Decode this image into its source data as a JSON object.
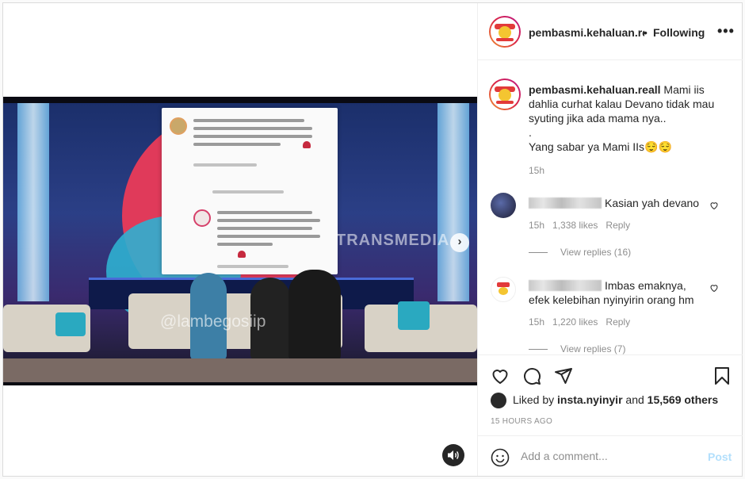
{
  "post": {
    "username": "pembasmi.kehaluan.reall",
    "header_username": "pembasmi.kehaluan.rea",
    "dot": "•",
    "follow_label": "Following",
    "more_label": "•••",
    "watermark_channel": "TRANSMEDIA",
    "watermark_account": "@lambegosiip",
    "caption_lines": [
      "Mami iis",
      "dahlia curhat kalau Devano tidak mau",
      "syuting jika ada mama nya..",
      ".",
      "Yang sabar ya Mami IIs😌😌"
    ],
    "caption_time": "15h"
  },
  "comments": [
    {
      "text": "Kasian yah devano",
      "time": "15h",
      "likes": "1,338 likes",
      "reply_label": "Reply",
      "view_replies": "View replies (16)"
    },
    {
      "text_line1": "Imbas emaknya,",
      "text_line2": "efek kelebihan nyinyirin orang hm",
      "time": "15h",
      "likes": "1,220 likes",
      "reply_label": "Reply",
      "view_replies": "View replies (7)"
    }
  ],
  "likes": {
    "prefix": "Liked by",
    "user": "insta.nyinyir",
    "and": "and",
    "others": "15,569 others"
  },
  "time_ago": "15 HOURS AGO",
  "comment_box": {
    "placeholder": "Add a comment...",
    "post_label": "Post"
  },
  "icons": {
    "like": "heart-icon",
    "comment": "comment-icon",
    "share": "paper-plane-icon",
    "save": "bookmark-icon",
    "emoji": "emoji-icon",
    "sound": "speaker-icon",
    "next": "chevron-right-icon"
  },
  "colors": {
    "text": "#262626",
    "muted": "#8e8e8e",
    "post_button": "#b2dffc",
    "border": "#dbdbdb"
  }
}
